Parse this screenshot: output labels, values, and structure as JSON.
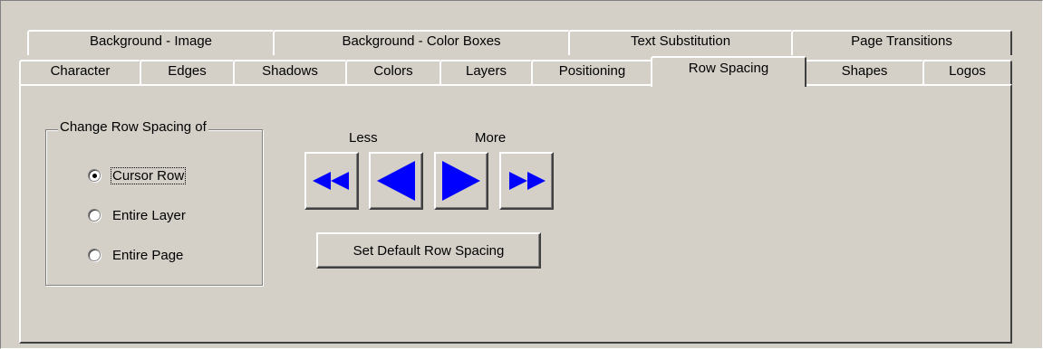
{
  "tabs": {
    "back_row": [
      "Background - Image",
      "Background - Color Boxes",
      "Text Substitution",
      "Page Transitions"
    ],
    "front_row": [
      "Character",
      "Edges",
      "Shadows",
      "Colors",
      "Layers",
      "Positioning",
      "Row Spacing",
      "Shapes",
      "Logos"
    ],
    "selected": "Row Spacing"
  },
  "group": {
    "legend": "Change Row Spacing of",
    "options": [
      {
        "label": "Cursor Row",
        "checked": true
      },
      {
        "label": "Entire Layer",
        "checked": false
      },
      {
        "label": "Entire Page",
        "checked": false
      }
    ]
  },
  "controls": {
    "less_label": "Less",
    "more_label": "More",
    "default_button": "Set Default Row Spacing"
  },
  "colors": {
    "arrow": "#0000ff",
    "face": "#d4d0c8"
  },
  "icons": [
    "double-left-arrow-icon",
    "left-arrow-icon",
    "right-arrow-icon",
    "double-right-arrow-icon"
  ]
}
